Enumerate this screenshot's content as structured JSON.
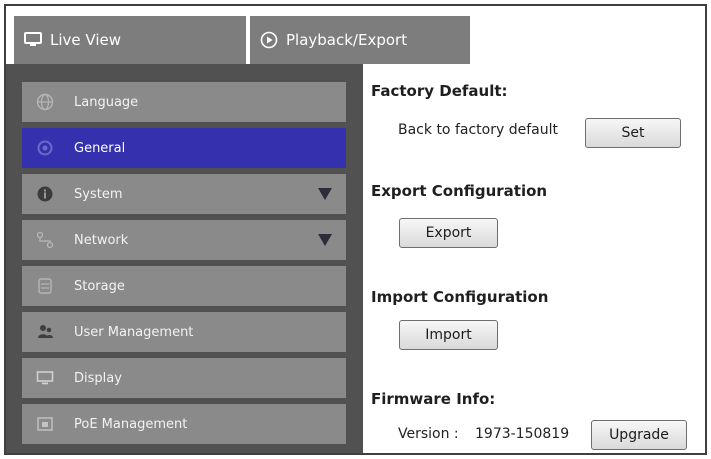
{
  "tabs": {
    "live_view": "Live View",
    "playback": "Playback/Export"
  },
  "sidebar": {
    "items": [
      {
        "label": "Language",
        "icon": "globe-icon"
      },
      {
        "label": "General",
        "icon": "gear-icon",
        "active": true
      },
      {
        "label": "System",
        "icon": "info-icon",
        "expandable": true
      },
      {
        "label": "Network",
        "icon": "network-icon",
        "expandable": true
      },
      {
        "label": "Storage",
        "icon": "storage-icon"
      },
      {
        "label": "User Management",
        "icon": "users-icon"
      },
      {
        "label": "Display",
        "icon": "monitor-icon"
      },
      {
        "label": "PoE Management",
        "icon": "poe-icon"
      }
    ]
  },
  "content": {
    "factory_default_heading": "Factory Default:",
    "factory_default_text": "Back to factory default",
    "set_button": "Set",
    "export_heading": "Export Configuration",
    "export_button": "Export",
    "import_heading": "Import Configuration",
    "import_button": "Import",
    "firmware_heading": "Firmware Info:",
    "firmware_version_label": "Version :",
    "firmware_version": "1973-150819",
    "upgrade_button": "Upgrade"
  },
  "colors": {
    "active_item": "#3530ad",
    "sidebar_bg": "#515151",
    "item_bg": "#8a8a8a",
    "tab_bg": "#7d7d7d"
  }
}
